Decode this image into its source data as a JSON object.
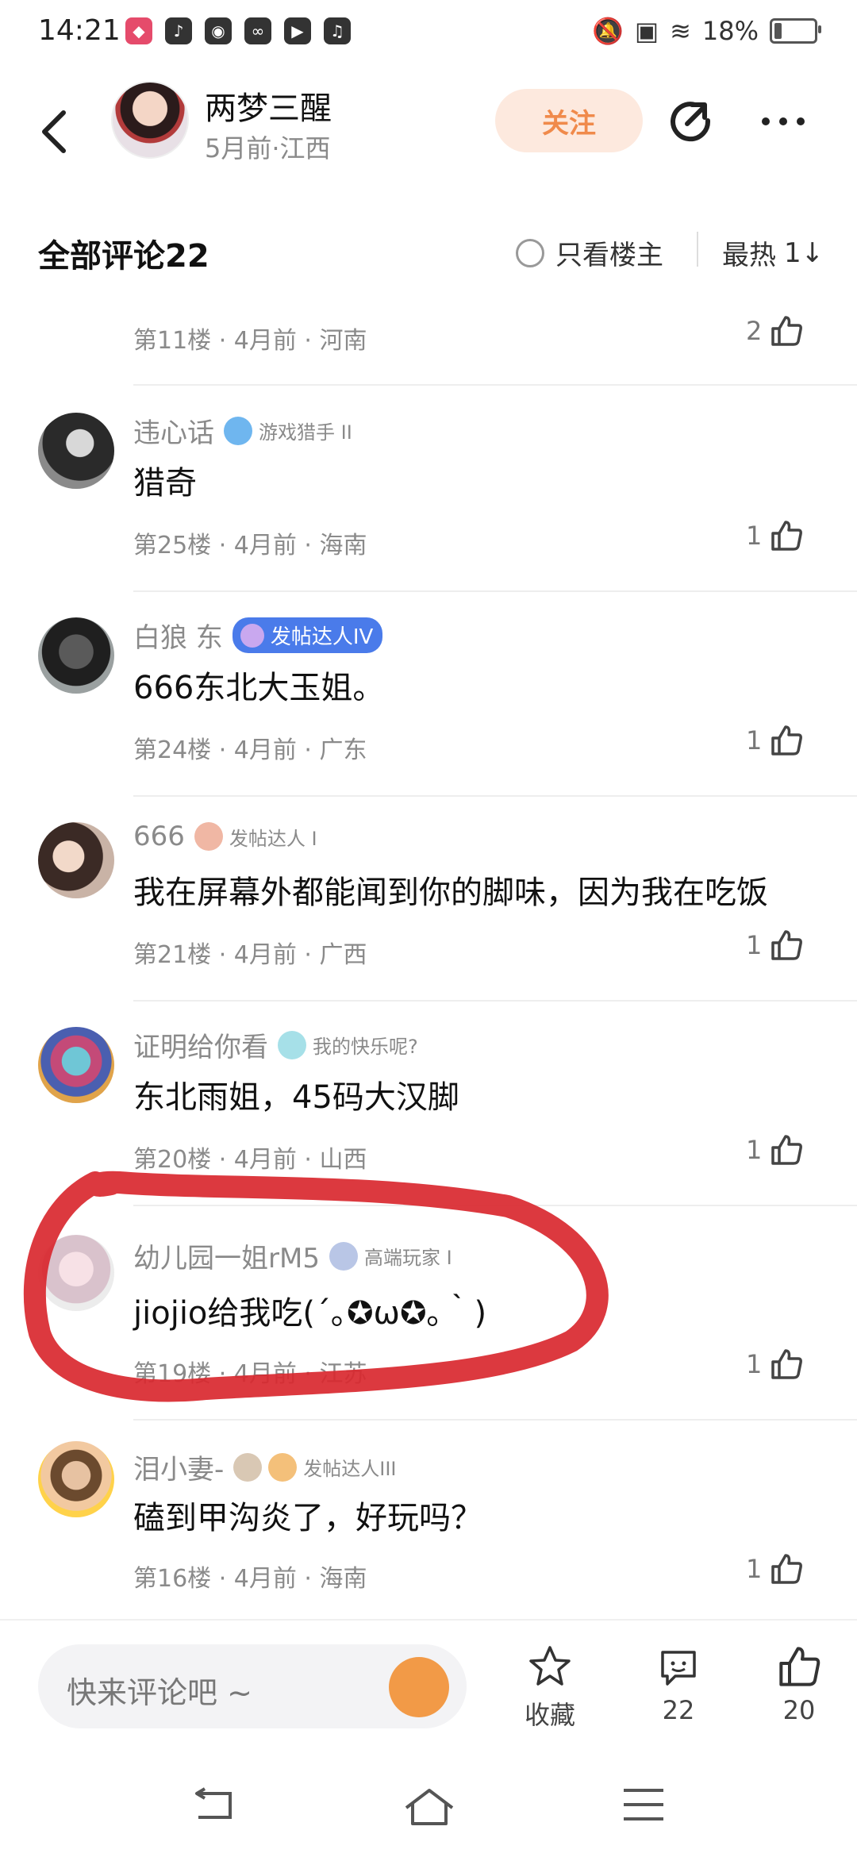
{
  "status": {
    "time": "14:21",
    "battery": "18%",
    "battery_level": 0.18
  },
  "header": {
    "author_name": "两梦三醒",
    "author_meta": "5月前·江西",
    "follow_label": "关注"
  },
  "comments_bar": {
    "title": "全部评论22",
    "only_op_label": "只看楼主",
    "sort_label": "最热",
    "sort_icon": "1↓"
  },
  "partial_comment": {
    "meta": "第11楼 · 4月前 · 河南",
    "likes": "2"
  },
  "comments": [
    {
      "user": "违心话",
      "badge": "游戏猎手 II",
      "text": "猎奇",
      "meta": "第25楼 · 4月前 · 海南",
      "likes": "1"
    },
    {
      "user": "白狼 东",
      "badge": "发帖达人IV",
      "text": "666东北大玉姐。",
      "meta": "第24楼 · 4月前 · 广东",
      "likes": "1"
    },
    {
      "user": "666",
      "badge": "发帖达人 I",
      "text": "我在屏幕外都能闻到你的脚味，因为我在吃饭",
      "meta": "第21楼 · 4月前 · 广西",
      "likes": "1"
    },
    {
      "user": "证明给你看",
      "badge": "我的快乐呢?",
      "text": "东北雨姐，45码大汉脚",
      "meta": "第20楼 · 4月前 · 山西",
      "likes": "1"
    },
    {
      "user": "幼儿园一姐rM5",
      "badge": "高端玩家 I",
      "text": "jiojio给我吃(´｡✪ω✪｡｀)",
      "meta": "第19楼 · 4月前 · 江苏",
      "likes": "1"
    },
    {
      "user": "泪小妻-",
      "badge": "发帖达人III",
      "text": "磕到甲沟炎了，好玩吗？",
      "meta": "第16楼 · 4月前 · 海南",
      "likes": "1"
    }
  ],
  "bottom": {
    "input_placeholder": "快来评论吧 ~",
    "collect_label": "收藏",
    "comment_count": "22",
    "like_count": "20"
  },
  "colors": {
    "accent": "#f08a4b",
    "follow_bg": "#fde9de",
    "annotation_red": "#d9282f"
  }
}
